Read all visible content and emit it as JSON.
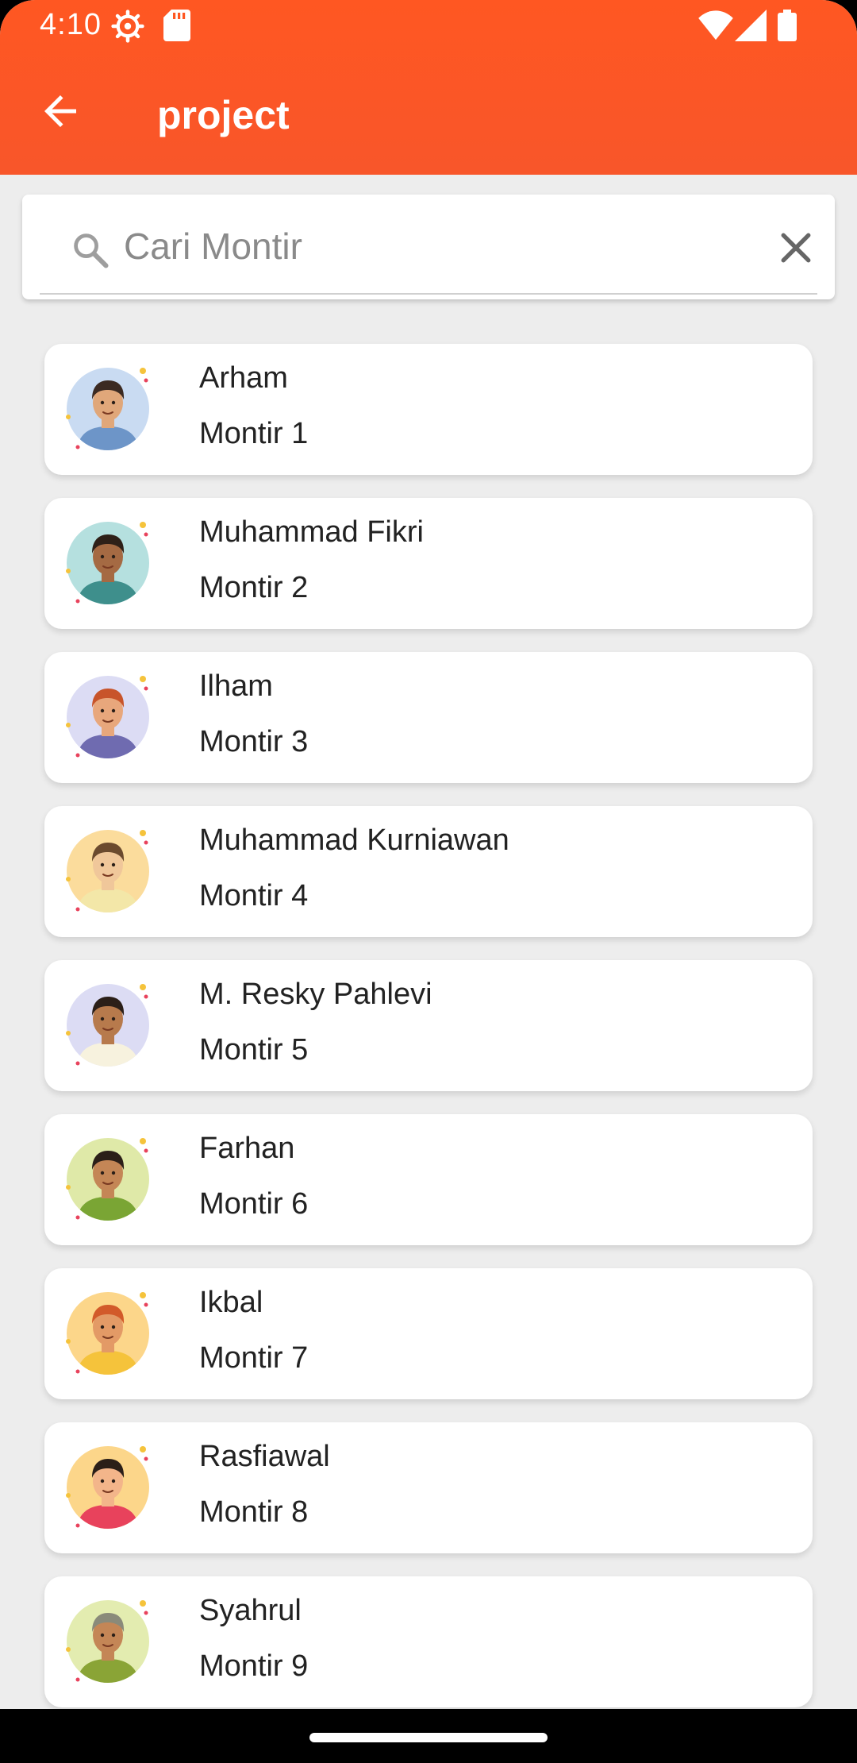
{
  "status_bar": {
    "time": "4:10"
  },
  "app_bar": {
    "title": "project",
    "color": "#ff5722"
  },
  "search": {
    "placeholder": "Cari Montir",
    "value": ""
  },
  "mechanics": [
    {
      "name": "Arham",
      "role": "Montir 1",
      "avatar_bg": "#c9dbf2",
      "shirt": "#6d95c8",
      "skin": "#e0a77a",
      "hair": "#3b2a22"
    },
    {
      "name": "Muhammad Fikri",
      "role": "Montir 2",
      "avatar_bg": "#b5e0df",
      "shirt": "#3e8f8c",
      "skin": "#a56a43",
      "hair": "#2e2018"
    },
    {
      "name": "Ilham",
      "role": "Montir 3",
      "avatar_bg": "#dcdcf4",
      "shirt": "#6f6bb0",
      "skin": "#e8a77c",
      "hair": "#c8542a"
    },
    {
      "name": "Muhammad Kurniawan",
      "role": "Montir 4",
      "avatar_bg": "#fbdc9c",
      "shirt": "#f3e7a8",
      "skin": "#f0c79a",
      "hair": "#6b4a2e"
    },
    {
      "name": "M. Resky Pahlevi",
      "role": "Montir 5",
      "avatar_bg": "#dcdcf4",
      "shirt": "#f7f2de",
      "skin": "#b77a4c",
      "hair": "#2b1f18"
    },
    {
      "name": "Farhan",
      "role": "Montir 6",
      "avatar_bg": "#dfe9a8",
      "shirt": "#7aa534",
      "skin": "#c48656",
      "hair": "#2b1f18"
    },
    {
      "name": "Ikbal",
      "role": "Montir 7",
      "avatar_bg": "#fcd68a",
      "shirt": "#f5c33b",
      "skin": "#e39a66",
      "hair": "#d25a2a"
    },
    {
      "name": "Rasfiawal",
      "role": "Montir 8",
      "avatar_bg": "#fcd68a",
      "shirt": "#e8425c",
      "skin": "#f3b58a",
      "hair": "#2b1f18"
    },
    {
      "name": "Syahrul",
      "role": "Montir 9",
      "avatar_bg": "#e3ecb0",
      "shirt": "#8aa436",
      "skin": "#c48656",
      "hair": "#8a8a7a"
    }
  ]
}
